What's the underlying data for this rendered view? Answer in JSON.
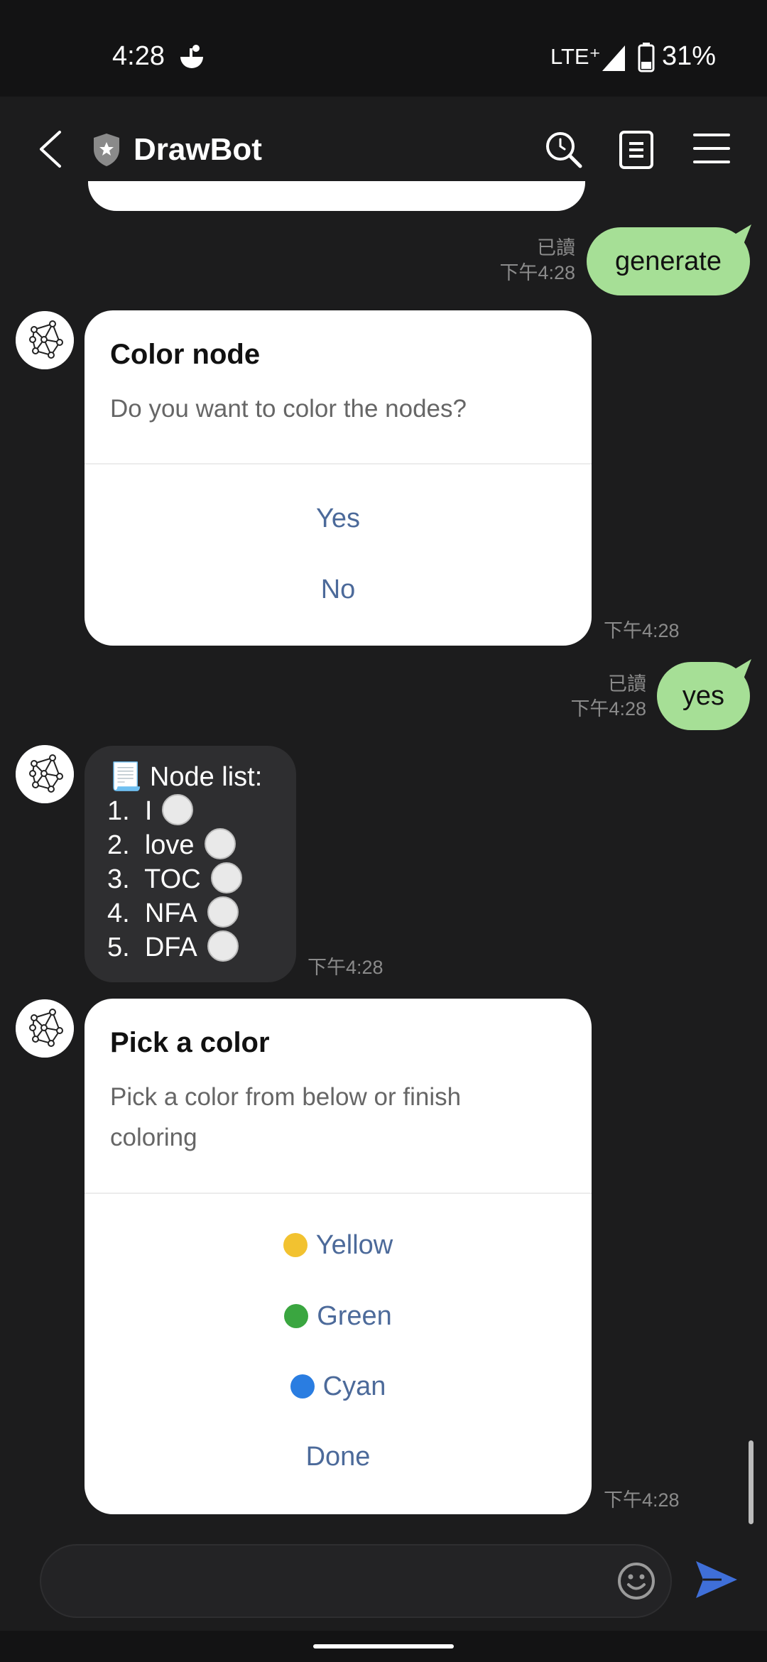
{
  "status_bar": {
    "time": "4:28",
    "network": "LTE⁺",
    "battery": "31%"
  },
  "header": {
    "title": "DrawBot"
  },
  "messages": {
    "m1": {
      "text": "generate",
      "read": "已讀",
      "time": "下午4:28"
    },
    "m2": {
      "title": "Color node",
      "description": "Do you want to color the nodes?",
      "buttons": [
        "Yes",
        "No"
      ],
      "time": "下午4:28"
    },
    "m3": {
      "text": "yes",
      "read": "已讀",
      "time": "下午4:28"
    },
    "m4": {
      "heading": "📃 Node list:",
      "items": [
        {
          "num": "1.",
          "label": "I"
        },
        {
          "num": "2.",
          "label": "love"
        },
        {
          "num": "3.",
          "label": "TOC"
        },
        {
          "num": "4.",
          "label": "NFA"
        },
        {
          "num": "5.",
          "label": "DFA"
        }
      ],
      "time": "下午4:28"
    },
    "m5": {
      "title": "Pick a color",
      "description": "Pick a color from below or finish coloring",
      "buttons": [
        {
          "label": "Yellow",
          "color": "#f2c230"
        },
        {
          "label": "Green",
          "color": "#3aa640"
        },
        {
          "label": "Cyan",
          "color": "#2a7de1"
        },
        {
          "label": "Done"
        }
      ],
      "time": "下午4:28"
    }
  },
  "colors": {
    "user_bubble": "#a6df96",
    "link": "#4c6a9a",
    "send": "#3f6fd8"
  }
}
